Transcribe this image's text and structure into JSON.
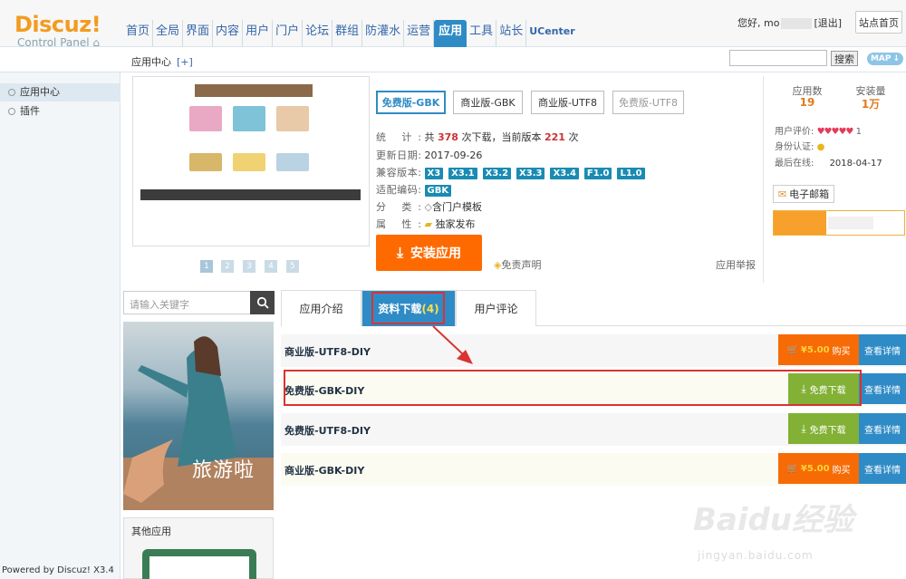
{
  "header": {
    "logo_title": "Discuz!",
    "logo_subtitle": "Control Panel",
    "nav": [
      "首页",
      "全局",
      "界面",
      "内容",
      "用户",
      "门户",
      "论坛",
      "群组",
      "防灌水",
      "运营",
      "应用",
      "工具",
      "站长",
      "UCenter"
    ],
    "active_nav": "应用",
    "welcome": "您好, mo",
    "logout": "[退出]",
    "site_home": "站点首页"
  },
  "subheader": {
    "crumb": "应用中心",
    "add": "[+]",
    "search_btn": "搜索",
    "map_btn": "MAP"
  },
  "sidebar": {
    "items": [
      "应用中心",
      "插件"
    ],
    "powered": "Powered by Discuz! X3.4"
  },
  "app": {
    "pages": [
      "1",
      "2",
      "3",
      "4",
      "5"
    ],
    "versions": [
      "免费版-GBK",
      "商业版-GBK",
      "商业版-UTF8",
      "免费版-UTF8"
    ],
    "stat_label": "统 计:",
    "stat_text_1": "共",
    "downloads": "378",
    "stat_text_2": "次下载，当前版本",
    "current_downloads": "221",
    "stat_text_3": "次",
    "updated_label": "更新日期:",
    "updated": "2017-09-26",
    "compat_label": "兼容版本:",
    "compat": [
      "X3",
      "X3.1",
      "X3.2",
      "X3.3",
      "X3.4",
      "F1.0",
      "L1.0"
    ],
    "encoding_label": "适配编码:",
    "encoding": "GBK",
    "category_label": "分 类:",
    "category": "含门户模板",
    "attr_label": "属 性:",
    "attr": "独家发布",
    "install": "安装应用",
    "disclaimer": "免责声明",
    "report": "应用举报"
  },
  "stats": {
    "app_count_label": "应用数",
    "app_count": "19",
    "installs_label": "安装量",
    "installs": "1万",
    "rating_label": "用户评价:",
    "rating_stars": "♥♥♥♥♥",
    "rating_value": "1",
    "auth_label": "身份认证:",
    "last_online_label": "最后在线:",
    "last_online": "2018-04-17",
    "email": "电子邮箱",
    "progress_fraction": 0.4
  },
  "left_panel": {
    "search_placeholder": "请输入关键字",
    "promo_text": "旅游啦",
    "other_title": "其他应用"
  },
  "tabs": {
    "items": [
      "应用介绍",
      "资料下载",
      "用户评论"
    ],
    "download_count": "(4)"
  },
  "downloads": [
    {
      "name": "商业版-UTF8-DIY",
      "type": "buy",
      "price": "¥5.00",
      "action": "购买",
      "view": "查看详情"
    },
    {
      "name": "免费版-GBK-DIY",
      "type": "free",
      "action": "免费下载",
      "view": "查看详情"
    },
    {
      "name": "免费版-UTF8-DIY",
      "type": "free",
      "action": "免费下载",
      "view": "查看详情"
    },
    {
      "name": "商业版-GBK-DIY",
      "type": "buy",
      "price": "¥5.00",
      "action": "购买",
      "view": "查看详情"
    }
  ],
  "watermark": {
    "brand": "Baidu经验",
    "url": "jingyan.baidu.com"
  },
  "colors": {
    "accent": "#2f8bc6",
    "install": "#ff6a00",
    "buy": "#f76b06",
    "free": "#82b136",
    "highlight": "#d93333"
  }
}
